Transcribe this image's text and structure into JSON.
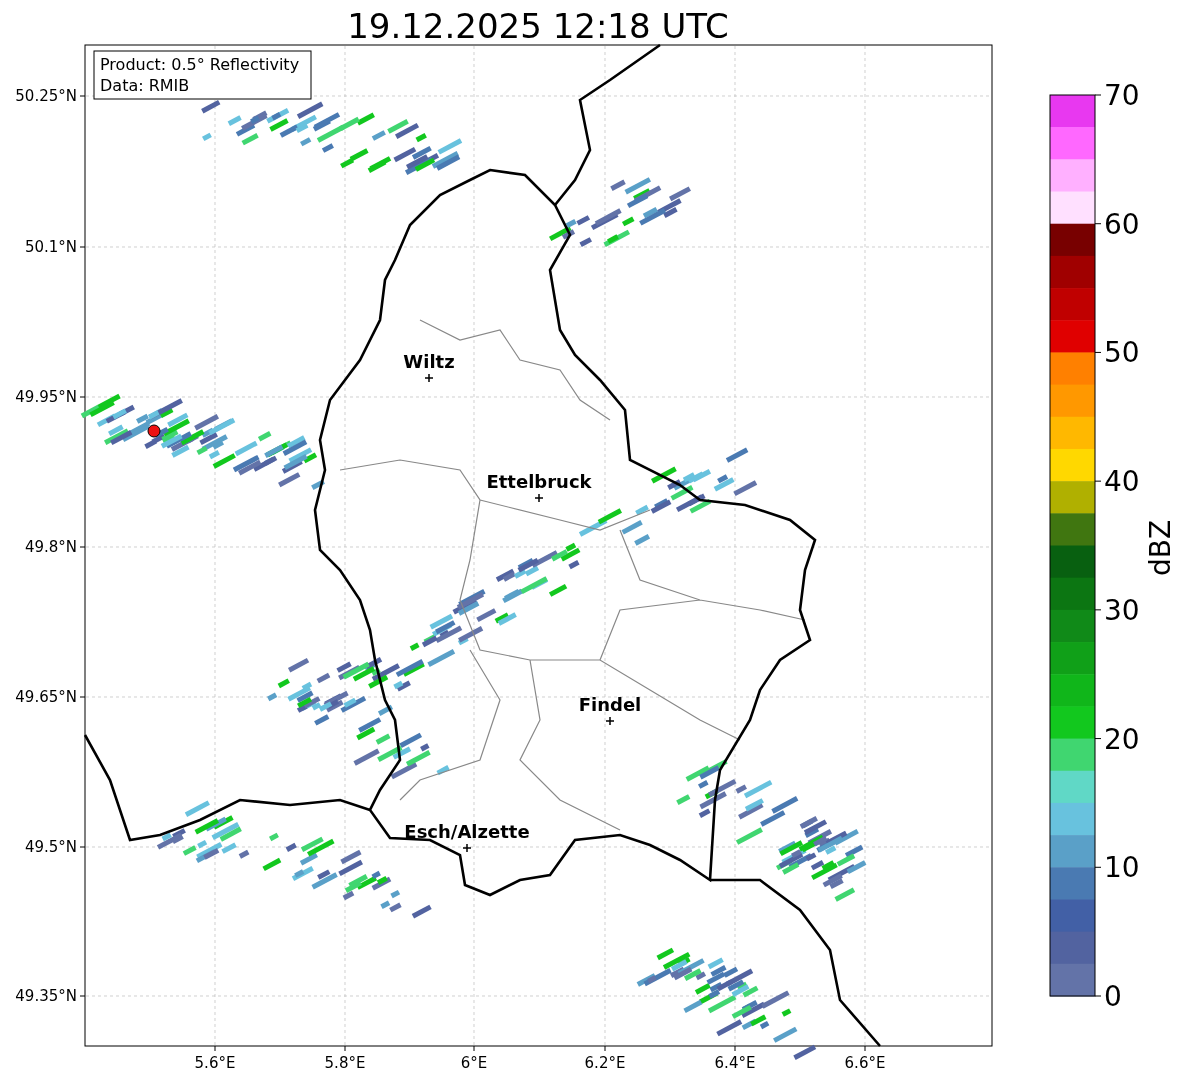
{
  "title": "19.12.2025 12:18 UTC",
  "info_box": [
    "Product: 0.5° Reflectivity",
    "Data: RMIB"
  ],
  "cities": [
    {
      "name": "Wiltz"
    },
    {
      "name": "Ettelbruck"
    },
    {
      "name": "Findel"
    },
    {
      "name": "Esch/Alzette"
    }
  ],
  "lat_ticks": [
    "50.25°N",
    "50.1°N",
    "49.95°N",
    "49.8°N",
    "49.65°N",
    "49.5°N",
    "49.35°N"
  ],
  "lon_ticks": [
    "5.6°E",
    "5.8°E",
    "6°E",
    "6.2°E",
    "6.4°E",
    "6.6°E"
  ],
  "colorbar": {
    "label": "dBZ",
    "ticks": [
      "70",
      "60",
      "50",
      "40",
      "30",
      "20",
      "10",
      "0"
    ],
    "bands": [
      {
        "color": "#e838f0"
      },
      {
        "color": "#ff68ff"
      },
      {
        "color": "#ffb0ff"
      },
      {
        "color": "#ffe0ff"
      },
      {
        "color": "#780000"
      },
      {
        "color": "#a00000"
      },
      {
        "color": "#c00000"
      },
      {
        "color": "#e00000"
      },
      {
        "color": "#ff8000"
      },
      {
        "color": "#ff9800"
      },
      {
        "color": "#ffb800"
      },
      {
        "color": "#ffd800"
      },
      {
        "color": "#b0b000"
      },
      {
        "color": "#407610"
      },
      {
        "color": "#086010"
      },
      {
        "color": "#0c7612"
      },
      {
        "color": "#108a18"
      },
      {
        "color": "#10a018"
      },
      {
        "color": "#10b61a"
      },
      {
        "color": "#12c81e"
      },
      {
        "color": "#40d670"
      },
      {
        "color": "#60d8c6"
      },
      {
        "color": "#68c2de"
      },
      {
        "color": "#5aa0c8"
      },
      {
        "color": "#4a7ab2"
      },
      {
        "color": "#4260a6"
      },
      {
        "color": "#5263a0"
      },
      {
        "color": "#6373a8"
      }
    ]
  }
}
